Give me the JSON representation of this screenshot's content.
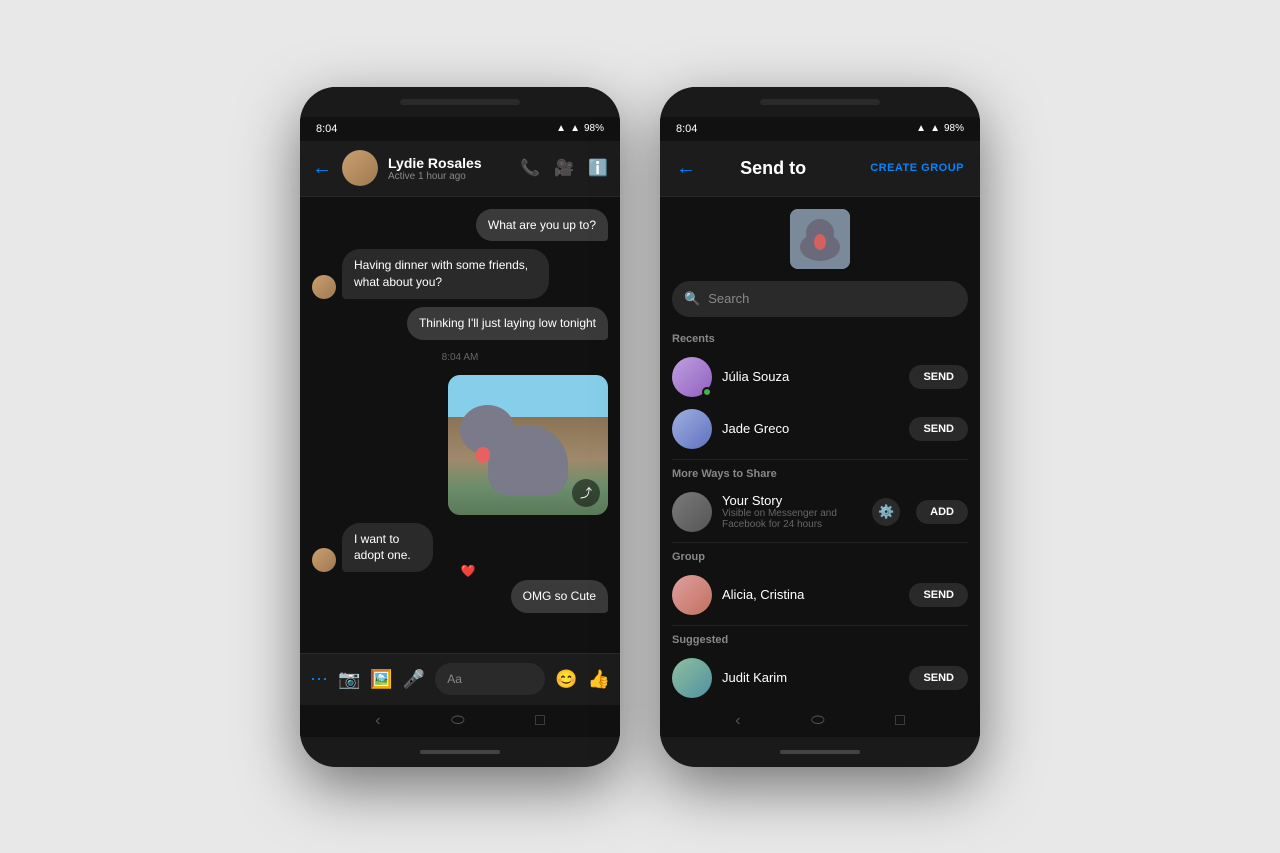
{
  "phone1": {
    "statusBar": {
      "time": "8:04",
      "signal": "▲",
      "battery": "98%"
    },
    "header": {
      "contactName": "Lydie Rosales",
      "contactStatus": "Active 1 hour ago",
      "backLabel": "←"
    },
    "messages": [
      {
        "id": 1,
        "type": "sent",
        "text": "What are you up to?"
      },
      {
        "id": 2,
        "type": "received",
        "text": "Having dinner with some friends, what about you?"
      },
      {
        "id": 3,
        "type": "sent",
        "text": "Thinking I'll just laying low tonight"
      },
      {
        "id": 4,
        "type": "timestamp",
        "text": "8:04 AM"
      },
      {
        "id": 5,
        "type": "image-sent"
      },
      {
        "id": 6,
        "type": "received",
        "text": "I want to adopt one."
      },
      {
        "id": 7,
        "type": "sent",
        "text": "OMG so Cute"
      }
    ],
    "inputPlaceholder": "Aa"
  },
  "phone2": {
    "statusBar": {
      "time": "8:04",
      "battery": "98%"
    },
    "header": {
      "title": "Send to",
      "createGroupLabel": "CREATE GROUP"
    },
    "search": {
      "placeholder": "Search"
    },
    "sections": {
      "recents": "Recents",
      "moreWays": "More Ways to Share",
      "group": "Group",
      "suggested": "Suggested"
    },
    "contacts": [
      {
        "id": 1,
        "name": "Júlia Souza",
        "section": "recents",
        "avatarClass": "av-julia",
        "action": "SEND"
      },
      {
        "id": 2,
        "name": "Jade Greco",
        "section": "recents",
        "avatarClass": "av-jade",
        "action": "SEND"
      },
      {
        "id": 3,
        "name": "Your Story",
        "section": "more",
        "sub": "Visible on Messenger and Facebook for 24 hours",
        "avatarClass": "av-your-story",
        "action": "ADD"
      },
      {
        "id": 4,
        "name": "Alicia, Cristina",
        "section": "group",
        "avatarClass": "av-alicia",
        "action": "SEND"
      },
      {
        "id": 5,
        "name": "Judit Karim",
        "section": "suggested",
        "avatarClass": "av-judit",
        "action": "SEND"
      }
    ]
  }
}
